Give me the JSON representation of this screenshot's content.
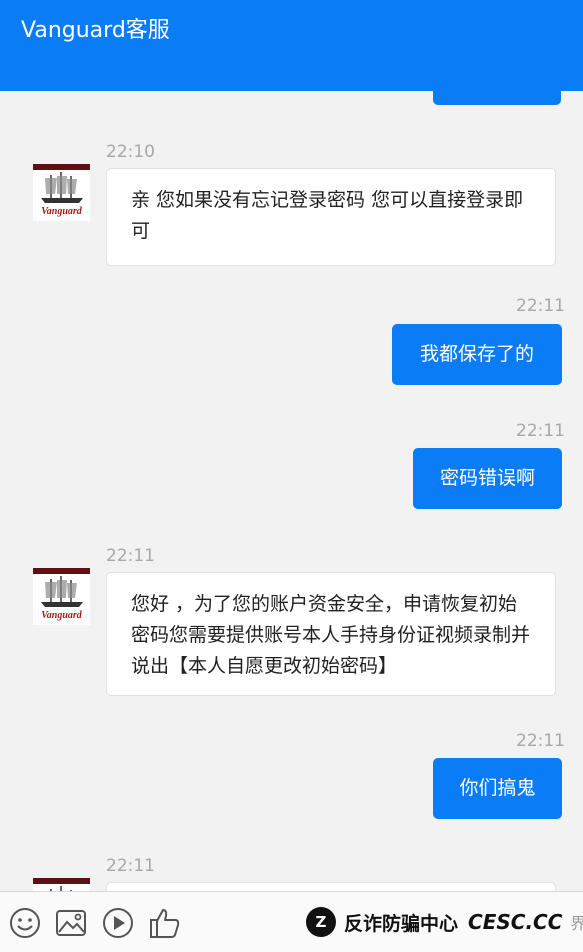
{
  "header": {
    "title": "Vanguard客服"
  },
  "avatar": {
    "label": "Vanguard"
  },
  "messages": [
    {
      "time": "22:10",
      "text": "亲 您如果没有忘记登录密码 您可以直接登录即可"
    },
    {
      "time": "22:11",
      "text": "我都保存了的"
    },
    {
      "time": "22:11",
      "text": "密码错误啊"
    },
    {
      "time": "22:11",
      "text": "您好 ，为了您的账户资金安全，申请恢复初始密码您需要提供账号本人手持身份证视频录制并说出【本人自愿更改初始密码】"
    },
    {
      "time": "22:11",
      "text": "你们搞鬼"
    },
    {
      "time": "22:11",
      "text": ""
    }
  ],
  "toolbar": {
    "icons": [
      "emoji-icon",
      "image-icon",
      "play-icon",
      "thumbs-up-icon"
    ]
  },
  "watermark": {
    "logo": "Z",
    "text": "反诈防骗中心",
    "site": "CESC.CC",
    "tail": "界"
  },
  "colors": {
    "accent": "#0a7cf6",
    "background": "#f2f2f2"
  }
}
